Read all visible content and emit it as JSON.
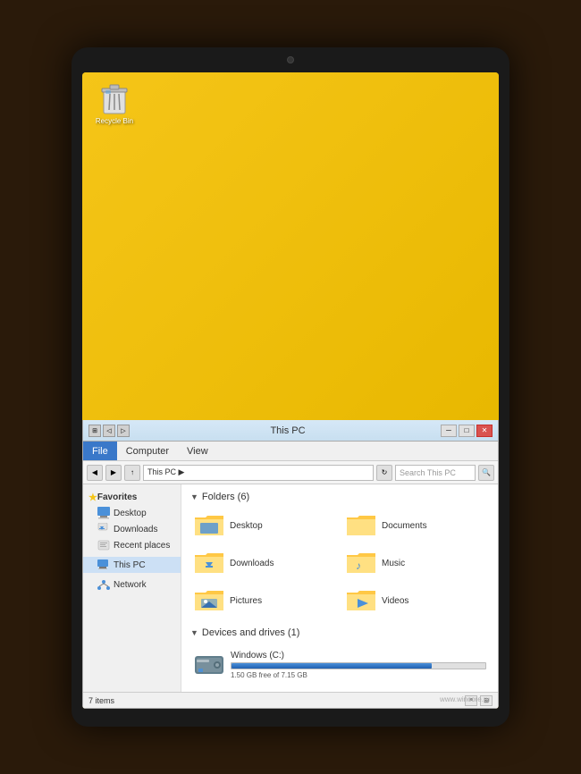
{
  "tablet": {
    "watermark": "www.wincore.ru"
  },
  "desktop": {
    "recycle_bin_label": "Recycle Bin"
  },
  "explorer": {
    "title": "This PC",
    "menu": {
      "file_label": "File",
      "computer_label": "Computer",
      "view_label": "View"
    },
    "address": "This PC ▶",
    "search_placeholder": "Search This PC",
    "folders_section_label": "Folders (6)",
    "devices_section_label": "Devices and drives (1)",
    "folders": [
      {
        "name": "Desktop"
      },
      {
        "name": "Documents"
      },
      {
        "name": "Downloads"
      },
      {
        "name": "Music"
      },
      {
        "name": "Pictures"
      },
      {
        "name": "Videos"
      }
    ],
    "drives": [
      {
        "name": "Windows (C:)",
        "space_label": "1.50 GB free of 7.15 GB",
        "fill_percent": 79
      }
    ],
    "sidebar": {
      "favorites_label": "Favorites",
      "items_favorites": [
        {
          "label": "Desktop"
        },
        {
          "label": "Downloads"
        },
        {
          "label": "Recent places"
        }
      ],
      "this_pc_label": "This PC",
      "network_label": "Network"
    },
    "status_bar": {
      "items_label": "7 items"
    }
  }
}
